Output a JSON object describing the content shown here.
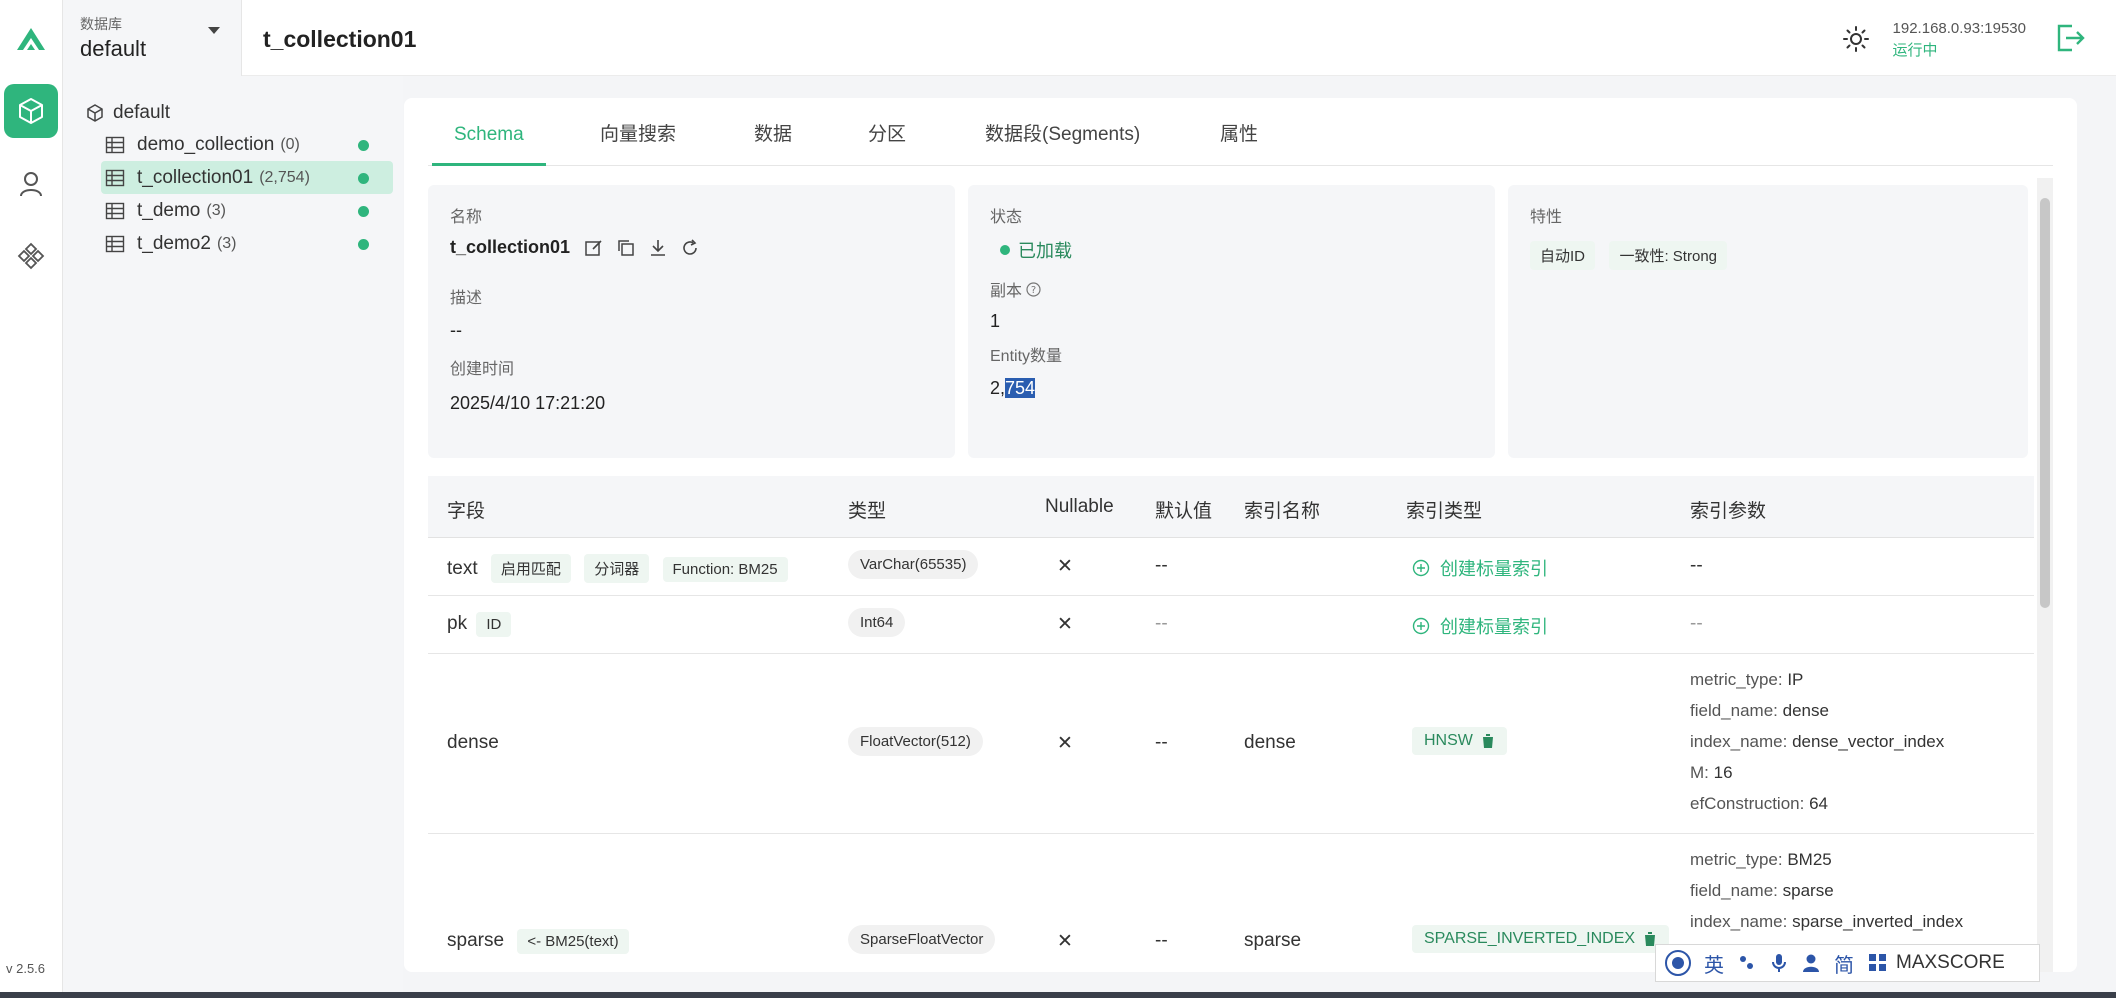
{
  "app": {
    "version": "v 2.5.6"
  },
  "database": {
    "label": "数据库",
    "value": "default"
  },
  "header": {
    "collection_title": "t_collection01",
    "host": "192.168.0.93:19530",
    "status": "运行中"
  },
  "tree": {
    "root": "default",
    "items": [
      {
        "name": "demo_collection",
        "count": "(0)"
      },
      {
        "name": "t_collection01",
        "count": "(2,754)"
      },
      {
        "name": "t_demo",
        "count": "(3)"
      },
      {
        "name": "t_demo2",
        "count": "(3)"
      }
    ]
  },
  "tabs": [
    "Schema",
    "向量搜索",
    "数据",
    "分区",
    "数据段(Segments)",
    "属性"
  ],
  "info": {
    "name_label": "名称",
    "name_value": "t_collection01",
    "desc_label": "描述",
    "desc_value": "--",
    "created_label": "创建时间",
    "created_value": "2025/4/10 17:21:20",
    "state_label": "状态",
    "state_value": "已加载",
    "replica_label": "副本",
    "replica_value": "1",
    "entity_label": "Entity数量",
    "entity_prefix": "2,",
    "entity_selected": "754",
    "features_label": "特性",
    "features": [
      "自动ID",
      "一致性: Strong"
    ]
  },
  "table": {
    "headers": [
      "字段",
      "类型",
      "Nullable",
      "默认值",
      "索引名称",
      "索引类型",
      "索引参数"
    ],
    "rows": [
      {
        "field": "text",
        "tags": [
          "启用匹配",
          "分词器",
          "Function: BM25"
        ],
        "type": "VarChar(65535)",
        "nullable": "✕",
        "default": "--",
        "index_name": "",
        "index_type": "创建标量索引",
        "params": "--"
      },
      {
        "field": "pk",
        "tags": [
          "ID"
        ],
        "type": "Int64",
        "nullable": "✕",
        "default": "--",
        "index_name": "",
        "index_type": "创建标量索引",
        "params": "--"
      },
      {
        "field": "dense",
        "tags": [],
        "type": "FloatVector(512)",
        "nullable": "✕",
        "default": "--",
        "index_name": "dense",
        "index_type": "HNSW",
        "params": [
          {
            "k": "metric_type:",
            "v": "IP"
          },
          {
            "k": "field_name:",
            "v": "dense"
          },
          {
            "k": "index_name:",
            "v": "dense_vector_index"
          },
          {
            "k": "M:",
            "v": "16"
          },
          {
            "k": "efConstruction:",
            "v": "64"
          }
        ]
      },
      {
        "field": "sparse",
        "tags": [
          "<- BM25(text)"
        ],
        "type": "SparseFloatVector",
        "nullable": "✕",
        "default": "--",
        "index_name": "sparse",
        "index_type": "SPARSE_INVERTED_INDEX",
        "params": [
          {
            "k": "metric_type:",
            "v": "BM25"
          },
          {
            "k": "field_name:",
            "v": "sparse"
          },
          {
            "k": "index_name:",
            "v": "sparse_inverted_index"
          }
        ]
      }
    ]
  },
  "ime": {
    "chars": [
      "英",
      "简"
    ],
    "tail": "MAXSCORE"
  },
  "colors": {
    "accent": "#2fb57d",
    "selection": "#2a5db0"
  }
}
